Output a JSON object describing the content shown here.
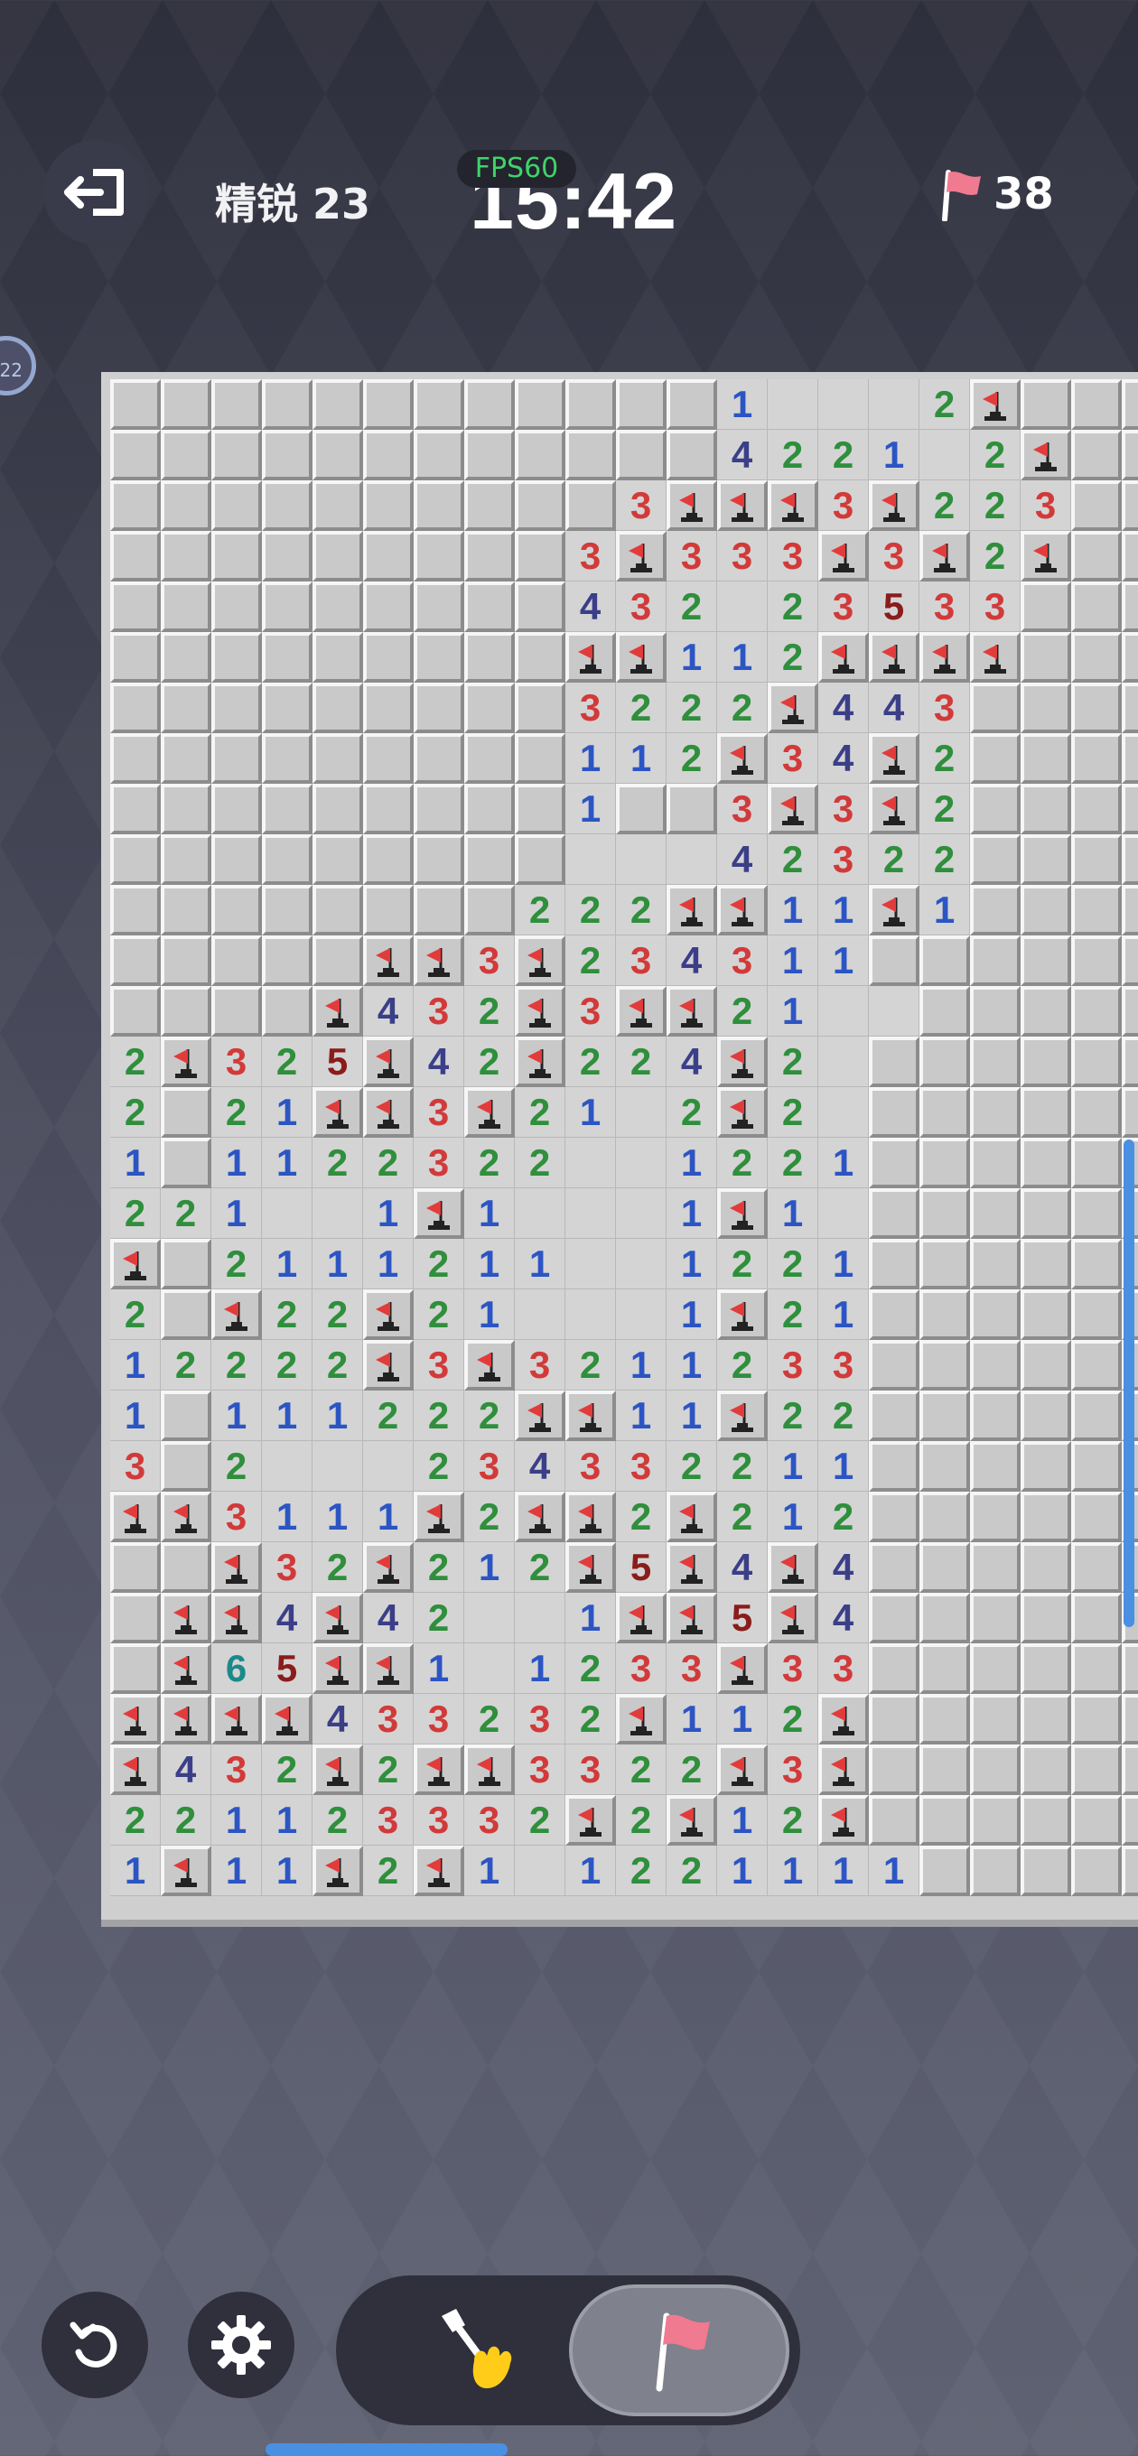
{
  "header": {
    "exit_icon": "exit-icon",
    "level_label": "精锐 23",
    "fps_label": "FPS60",
    "timer": "15:42",
    "flags_remaining": "38",
    "flag_icon": "flag-icon",
    "side_badge": "22"
  },
  "board": {
    "cols": 21,
    "rows": 30,
    "rows_data": [
      "############1...2F",
      "############4221.2F",
      "##########3FFF3F223",
      "#########3F333F3F2F",
      "#########432.23533",
      "#########FF112FFFF",
      "#########3222F443",
      "#########112F34F2",
      "#########1##3F3F2",
      "#########...42322",
      "########222FF11F1",
      "#####FF3F234311",
      "####F432F3FF21..",
      "2F325F42F224F2.",
      "2#21FF3F21.2F2.",
      "1#1122322..1221",
      "221..1F1...1F1.",
      "F#2111211..1221",
      "2#F22F21...1F21",
      "12222F3F3211233",
      "1#111222FF11F22",
      "3#2...234332211",
      "FF3111F2FF2F212",
      "##F32F212F5F4F4",
      "#FF4F42..1FF5F4",
      "#F65FF1.1233F33",
      "FFFF433232F112F",
      "F432F2FF3322F3F",
      "221123332F2F12F",
      "1F11F2F1.1221111"
    ],
    "flag_color": "#e23b3b",
    "num_colors": {
      "1": "#2c55c4",
      "2": "#2f8f3c",
      "3": "#d23a3a",
      "4": "#3b3f88",
      "5": "#8a1c1c",
      "6": "#1a8a8a",
      "7": "#333333"
    }
  },
  "controls": {
    "undo_icon": "undo-icon",
    "settings_icon": "gear-icon",
    "dig_mode_icon": "shovel-hand-icon",
    "flag_mode_icon": "flag-icon",
    "active_mode": "flag"
  }
}
